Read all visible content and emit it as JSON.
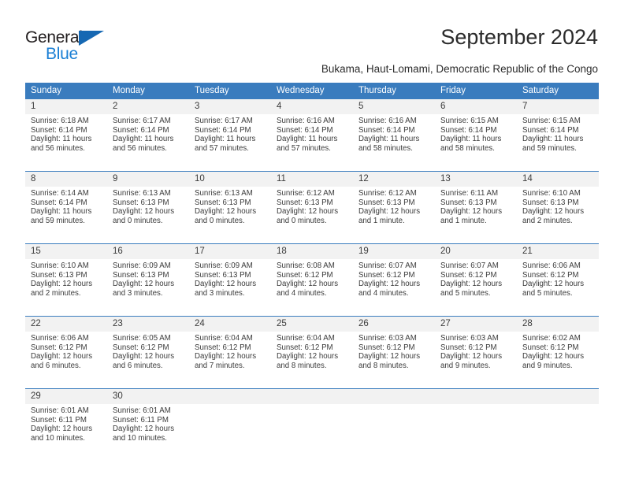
{
  "brand": {
    "name_part1": "General",
    "name_part2": "Blue",
    "accent_color": "#1a7fd4",
    "triangle_color": "#1668b3"
  },
  "header": {
    "title": "September 2024",
    "subtitle": "Bukama, Haut-Lomami, Democratic Republic of the Congo"
  },
  "calendar": {
    "header_bg": "#3a7cbe",
    "daynum_bg": "#f2f2f2",
    "weekday_headers": [
      "Sunday",
      "Monday",
      "Tuesday",
      "Wednesday",
      "Thursday",
      "Friday",
      "Saturday"
    ],
    "weeks": [
      [
        {
          "day": "1",
          "sunrise": "Sunrise: 6:18 AM",
          "sunset": "Sunset: 6:14 PM",
          "daylight": "Daylight: 11 hours and 56 minutes."
        },
        {
          "day": "2",
          "sunrise": "Sunrise: 6:17 AM",
          "sunset": "Sunset: 6:14 PM",
          "daylight": "Daylight: 11 hours and 56 minutes."
        },
        {
          "day": "3",
          "sunrise": "Sunrise: 6:17 AM",
          "sunset": "Sunset: 6:14 PM",
          "daylight": "Daylight: 11 hours and 57 minutes."
        },
        {
          "day": "4",
          "sunrise": "Sunrise: 6:16 AM",
          "sunset": "Sunset: 6:14 PM",
          "daylight": "Daylight: 11 hours and 57 minutes."
        },
        {
          "day": "5",
          "sunrise": "Sunrise: 6:16 AM",
          "sunset": "Sunset: 6:14 PM",
          "daylight": "Daylight: 11 hours and 58 minutes."
        },
        {
          "day": "6",
          "sunrise": "Sunrise: 6:15 AM",
          "sunset": "Sunset: 6:14 PM",
          "daylight": "Daylight: 11 hours and 58 minutes."
        },
        {
          "day": "7",
          "sunrise": "Sunrise: 6:15 AM",
          "sunset": "Sunset: 6:14 PM",
          "daylight": "Daylight: 11 hours and 59 minutes."
        }
      ],
      [
        {
          "day": "8",
          "sunrise": "Sunrise: 6:14 AM",
          "sunset": "Sunset: 6:14 PM",
          "daylight": "Daylight: 11 hours and 59 minutes."
        },
        {
          "day": "9",
          "sunrise": "Sunrise: 6:13 AM",
          "sunset": "Sunset: 6:13 PM",
          "daylight": "Daylight: 12 hours and 0 minutes."
        },
        {
          "day": "10",
          "sunrise": "Sunrise: 6:13 AM",
          "sunset": "Sunset: 6:13 PM",
          "daylight": "Daylight: 12 hours and 0 minutes."
        },
        {
          "day": "11",
          "sunrise": "Sunrise: 6:12 AM",
          "sunset": "Sunset: 6:13 PM",
          "daylight": "Daylight: 12 hours and 0 minutes."
        },
        {
          "day": "12",
          "sunrise": "Sunrise: 6:12 AM",
          "sunset": "Sunset: 6:13 PM",
          "daylight": "Daylight: 12 hours and 1 minute."
        },
        {
          "day": "13",
          "sunrise": "Sunrise: 6:11 AM",
          "sunset": "Sunset: 6:13 PM",
          "daylight": "Daylight: 12 hours and 1 minute."
        },
        {
          "day": "14",
          "sunrise": "Sunrise: 6:10 AM",
          "sunset": "Sunset: 6:13 PM",
          "daylight": "Daylight: 12 hours and 2 minutes."
        }
      ],
      [
        {
          "day": "15",
          "sunrise": "Sunrise: 6:10 AM",
          "sunset": "Sunset: 6:13 PM",
          "daylight": "Daylight: 12 hours and 2 minutes."
        },
        {
          "day": "16",
          "sunrise": "Sunrise: 6:09 AM",
          "sunset": "Sunset: 6:13 PM",
          "daylight": "Daylight: 12 hours and 3 minutes."
        },
        {
          "day": "17",
          "sunrise": "Sunrise: 6:09 AM",
          "sunset": "Sunset: 6:13 PM",
          "daylight": "Daylight: 12 hours and 3 minutes."
        },
        {
          "day": "18",
          "sunrise": "Sunrise: 6:08 AM",
          "sunset": "Sunset: 6:12 PM",
          "daylight": "Daylight: 12 hours and 4 minutes."
        },
        {
          "day": "19",
          "sunrise": "Sunrise: 6:07 AM",
          "sunset": "Sunset: 6:12 PM",
          "daylight": "Daylight: 12 hours and 4 minutes."
        },
        {
          "day": "20",
          "sunrise": "Sunrise: 6:07 AM",
          "sunset": "Sunset: 6:12 PM",
          "daylight": "Daylight: 12 hours and 5 minutes."
        },
        {
          "day": "21",
          "sunrise": "Sunrise: 6:06 AM",
          "sunset": "Sunset: 6:12 PM",
          "daylight": "Daylight: 12 hours and 5 minutes."
        }
      ],
      [
        {
          "day": "22",
          "sunrise": "Sunrise: 6:06 AM",
          "sunset": "Sunset: 6:12 PM",
          "daylight": "Daylight: 12 hours and 6 minutes."
        },
        {
          "day": "23",
          "sunrise": "Sunrise: 6:05 AM",
          "sunset": "Sunset: 6:12 PM",
          "daylight": "Daylight: 12 hours and 6 minutes."
        },
        {
          "day": "24",
          "sunrise": "Sunrise: 6:04 AM",
          "sunset": "Sunset: 6:12 PM",
          "daylight": "Daylight: 12 hours and 7 minutes."
        },
        {
          "day": "25",
          "sunrise": "Sunrise: 6:04 AM",
          "sunset": "Sunset: 6:12 PM",
          "daylight": "Daylight: 12 hours and 8 minutes."
        },
        {
          "day": "26",
          "sunrise": "Sunrise: 6:03 AM",
          "sunset": "Sunset: 6:12 PM",
          "daylight": "Daylight: 12 hours and 8 minutes."
        },
        {
          "day": "27",
          "sunrise": "Sunrise: 6:03 AM",
          "sunset": "Sunset: 6:12 PM",
          "daylight": "Daylight: 12 hours and 9 minutes."
        },
        {
          "day": "28",
          "sunrise": "Sunrise: 6:02 AM",
          "sunset": "Sunset: 6:12 PM",
          "daylight": "Daylight: 12 hours and 9 minutes."
        }
      ],
      [
        {
          "day": "29",
          "sunrise": "Sunrise: 6:01 AM",
          "sunset": "Sunset: 6:11 PM",
          "daylight": "Daylight: 12 hours and 10 minutes."
        },
        {
          "day": "30",
          "sunrise": "Sunrise: 6:01 AM",
          "sunset": "Sunset: 6:11 PM",
          "daylight": "Daylight: 12 hours and 10 minutes."
        },
        {
          "day": "",
          "sunrise": "",
          "sunset": "",
          "daylight": ""
        },
        {
          "day": "",
          "sunrise": "",
          "sunset": "",
          "daylight": ""
        },
        {
          "day": "",
          "sunrise": "",
          "sunset": "",
          "daylight": ""
        },
        {
          "day": "",
          "sunrise": "",
          "sunset": "",
          "daylight": ""
        },
        {
          "day": "",
          "sunrise": "",
          "sunset": "",
          "daylight": ""
        }
      ]
    ]
  }
}
